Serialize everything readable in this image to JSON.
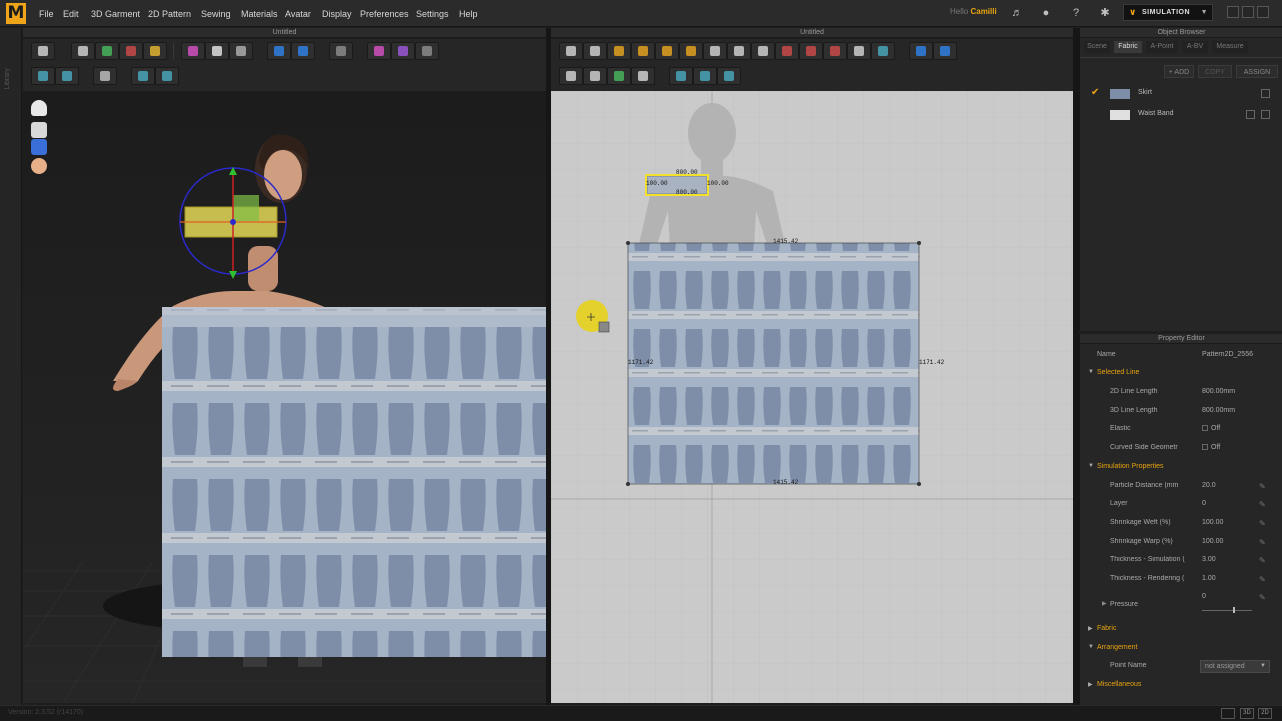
{
  "app": {
    "logo_letter": "M"
  },
  "menu": [
    "File",
    "Edit",
    "3D Garment",
    "2D Pattern",
    "Sewing",
    "Materials",
    "Avatar",
    "Display",
    "Preferences",
    "Settings",
    "Help"
  ],
  "user": {
    "greeting": "Hello",
    "name": "Camilli"
  },
  "mode_selector": {
    "label": "SIMULATION"
  },
  "library_label": "Library",
  "window_3d": {
    "title": "Untitled"
  },
  "window_2d": {
    "title": "Untitled",
    "measurements": {
      "small_top": "800.00",
      "small_bottom": "800.00",
      "small_left": "100.00",
      "small_right": "100.00",
      "big_top": "1415.42",
      "big_bottom": "1415.42",
      "big_left": "1171.42",
      "big_right": "1171.42"
    }
  },
  "object_browser": {
    "title": "Object Browser",
    "tabs": [
      "Scene",
      "Fabric",
      "A-Point",
      "A-BV",
      "Measure"
    ],
    "active_tab": "Fabric",
    "actions": {
      "add": "+ ADD",
      "copy": "COPY",
      "assign": "ASSIGN"
    },
    "fabrics": [
      {
        "name": "Skirt",
        "selected": true,
        "swatch": "#7f8ea8"
      },
      {
        "name": "Waist Band",
        "selected": false,
        "swatch": "#e0e0e0"
      }
    ]
  },
  "property_editor": {
    "title": "Property Editor",
    "name_label": "Name",
    "name_value": "Pattern2D_2556",
    "selected_line": {
      "title": "Selected Line",
      "rows": [
        {
          "label": "2D Line Length",
          "value": "800.00mm"
        },
        {
          "label": "3D Line Length",
          "value": "800.00mm"
        },
        {
          "label": "Elastic",
          "value": "Off"
        },
        {
          "label": "Curved Side Geometr",
          "value": "Off"
        }
      ]
    },
    "simulation_properties": {
      "title": "Simulation Properties",
      "rows": [
        {
          "label": "Particle Distance (mm",
          "value": "20.0"
        },
        {
          "label": "Layer",
          "value": "0"
        },
        {
          "label": "Shrinkage Weft (%)",
          "value": "100.00"
        },
        {
          "label": "Shrinkage Warp (%)",
          "value": "100.00"
        },
        {
          "label": "Thickness - Simulation (",
          "value": "3.00"
        },
        {
          "label": "Thickness - Rendering (",
          "value": "1.00"
        }
      ],
      "pressure_label": "Pressure",
      "pressure_value": "0"
    },
    "fabric_section": "Fabric",
    "arrangement": {
      "title": "Arrangement",
      "point_name_label": "Point Name",
      "point_name_value": "not assigned"
    },
    "misc_section": "Miscellaneous"
  },
  "status": {
    "version": "Version: 2.3.52   (r14170)"
  },
  "colors": {
    "accent": "#f0a419",
    "fabric": "#7f8ea8",
    "selection": "#f2e55a"
  }
}
